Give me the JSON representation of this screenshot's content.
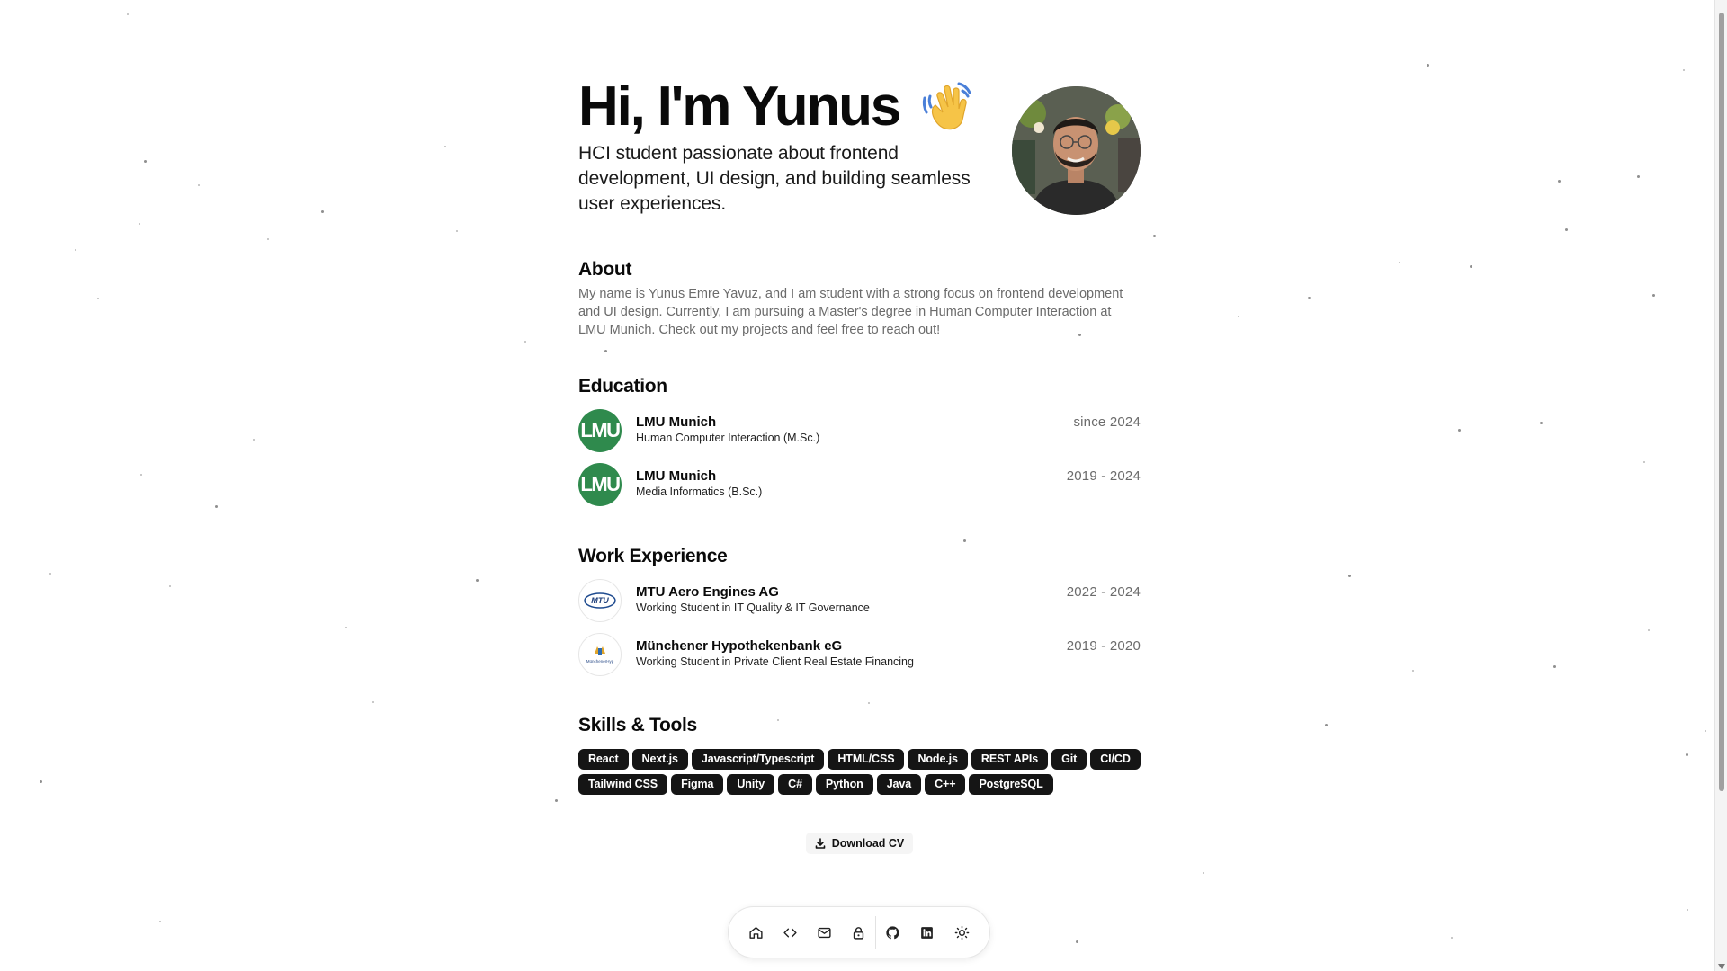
{
  "hero": {
    "title": "Hi, I'm Yunus",
    "subtitle": "HCI student passionate about frontend development, UI design, and building seamless user experiences."
  },
  "about": {
    "title": "About",
    "text": "My name is Yunus Emre Yavuz, and I am student with a strong focus on frontend development and UI design. Currently, I am pursuing a Master's degree in Human Computer Interaction at LMU Munich. Check out my projects and feel free to reach out!"
  },
  "education": {
    "title": "Education",
    "items": [
      {
        "logo_text": "LMU",
        "name": "LMU Munich",
        "role": "Human Computer Interaction (M.Sc.)",
        "date": "since 2024"
      },
      {
        "logo_text": "LMU",
        "name": "LMU Munich",
        "role": "Media Informatics (B.Sc.)",
        "date": "2019 - 2024"
      }
    ]
  },
  "work": {
    "title": "Work Experience",
    "items": [
      {
        "logo_text": "MTU",
        "name": "MTU Aero Engines AG",
        "role": "Working Student in IT Quality & IT Governance",
        "date": "2022 - 2024"
      },
      {
        "logo_text": "MünchenerHyp",
        "name": "Münchener Hypothekenbank eG",
        "role": "Working Student in Private Client Real Estate Financing",
        "date": "2019 - 2020"
      }
    ]
  },
  "skills": {
    "title": "Skills & Tools",
    "tags": [
      "React",
      "Next.js",
      "Javascript/Typescript",
      "HTML/CSS",
      "Node.js",
      "REST APIs",
      "Git",
      "CI/CD",
      "Tailwind CSS",
      "Figma",
      "Unity",
      "C#",
      "Python",
      "Java",
      "C++",
      "PostgreSQL"
    ]
  },
  "cv": {
    "label": "Download CV"
  },
  "dock": {
    "items": [
      "home-icon",
      "code-icon",
      "mail-icon",
      "lock-icon",
      "github-icon",
      "linkedin-icon",
      "sun-icon"
    ]
  },
  "colors": {
    "lmu_green": "#2f8a4d",
    "tag_bg": "#151515",
    "muted_text": "#6b6b6b"
  }
}
